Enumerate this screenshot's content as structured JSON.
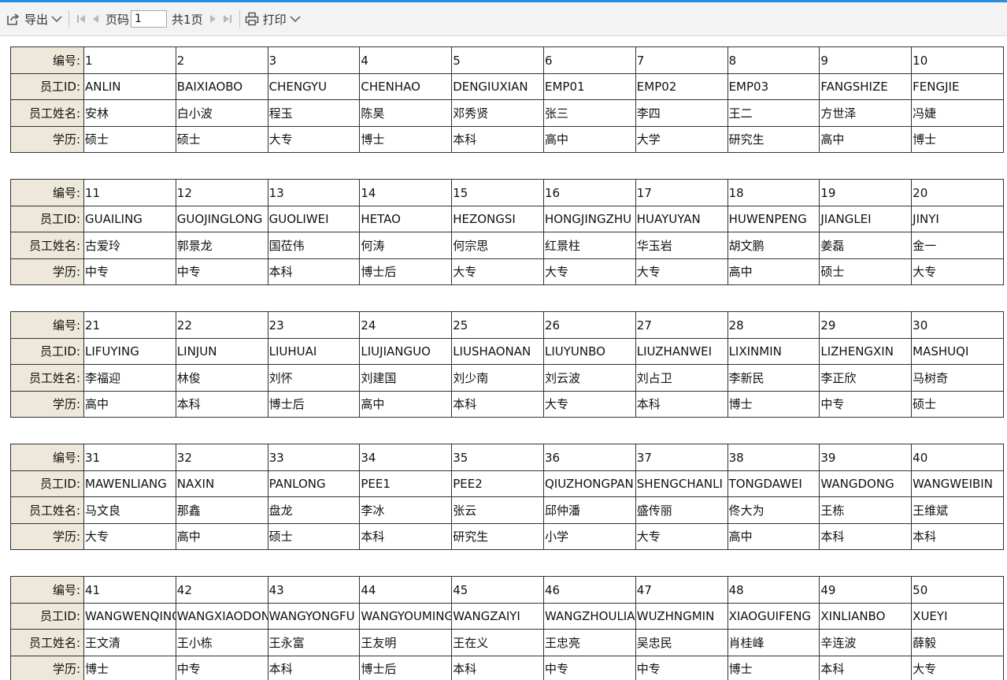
{
  "toolbar": {
    "export_label": "导出",
    "page_label": "页码",
    "page_value": "1",
    "total_label": "共1页",
    "print_label": "打印"
  },
  "row_labels": {
    "id": "编号:",
    "emp_id": "员工ID:",
    "name": "员工姓名:",
    "edu": "学历:"
  },
  "blocks": [
    {
      "ids": [
        "1",
        "2",
        "3",
        "4",
        "5",
        "6",
        "7",
        "8",
        "9",
        "10"
      ],
      "emp_ids": [
        "ANLIN",
        "BAIXIAOBO",
        "CHENGYU",
        "CHENHAO",
        "DENGIUXIAN",
        "EMP01",
        "EMP02",
        "EMP03",
        "FANGSHIZE",
        "FENGJIE"
      ],
      "names": [
        "安林",
        "白小波",
        "程玉",
        "陈昊",
        "邓秀贤",
        "张三",
        "李四",
        "王二",
        "方世泽",
        "冯婕"
      ],
      "edus": [
        "硕士",
        "硕士",
        "大专",
        "博士",
        "本科",
        "高中",
        "大学",
        "研究生",
        "高中",
        "博士"
      ]
    },
    {
      "ids": [
        "11",
        "12",
        "13",
        "14",
        "15",
        "16",
        "17",
        "18",
        "19",
        "20"
      ],
      "emp_ids": [
        "GUAILING",
        "GUOJINGLONG",
        "GUOLIWEI",
        "HETAO",
        "HEZONGSI",
        "HONGJINGZHU",
        "HUAYUYAN",
        "HUWENPENG",
        "JIANGLEI",
        "JINYI"
      ],
      "names": [
        "古爱玲",
        "郭景龙",
        "国莅伟",
        "何涛",
        "何宗思",
        "红景柱",
        "华玉岩",
        "胡文鹏",
        "姜磊",
        "金一"
      ],
      "edus": [
        "中专",
        "中专",
        "本科",
        "博士后",
        "大专",
        "大专",
        "大专",
        "高中",
        "硕士",
        "大专"
      ]
    },
    {
      "ids": [
        "21",
        "22",
        "23",
        "24",
        "25",
        "26",
        "27",
        "28",
        "29",
        "30"
      ],
      "emp_ids": [
        "LIFUYING",
        "LINJUN",
        "LIUHUAI",
        "LIUJIANGUO",
        "LIUSHAONAN",
        "LIUYUNBO",
        "LIUZHANWEI",
        "LIXINMIN",
        "LIZHENGXIN",
        "MASHUQI"
      ],
      "names": [
        "李福迎",
        "林俊",
        "刘怀",
        "刘建国",
        "刘少南",
        "刘云波",
        "刘占卫",
        "李新民",
        "李正欣",
        "马树奇"
      ],
      "edus": [
        "高中",
        "本科",
        "博士后",
        "高中",
        "本科",
        "大专",
        "本科",
        "博士",
        "中专",
        "硕士"
      ]
    },
    {
      "ids": [
        "31",
        "32",
        "33",
        "34",
        "35",
        "36",
        "37",
        "38",
        "39",
        "40"
      ],
      "emp_ids": [
        "MAWENLIANG",
        "NAXIN",
        "PANLONG",
        "PEE1",
        "PEE2",
        "QIUZHONGPAN",
        "SHENGCHANLI",
        "TONGDAWEI",
        "WANGDONG",
        "WANGWEIBIN"
      ],
      "names": [
        "马文良",
        "那鑫",
        "盘龙",
        "李冰",
        "张云",
        "邱仲潘",
        "盛传丽",
        "佟大为",
        "王栋",
        "王维斌"
      ],
      "edus": [
        "大专",
        "高中",
        "硕士",
        "本科",
        "研究生",
        "小学",
        "大专",
        "高中",
        "本科",
        "本科"
      ]
    },
    {
      "ids": [
        "41",
        "42",
        "43",
        "44",
        "45",
        "46",
        "47",
        "48",
        "49",
        "50"
      ],
      "emp_ids": [
        "WANGWENQING",
        "WANGXIAODONG",
        "WANGYONGFU",
        "WANGYOUMING",
        "WANGZAIYI",
        "WANGZHOULIANG",
        "WUZHNGMIN",
        "XIAOGUIFENG",
        "XINLIANBO",
        "XUEYI"
      ],
      "names": [
        "王文清",
        "王小栋",
        "王永富",
        "王友明",
        "王在义",
        "王忠亮",
        "吴忠民",
        "肖桂峰",
        "辛连波",
        "薛毅"
      ],
      "edus": [
        "博士",
        "中专",
        "本科",
        "博士后",
        "本科",
        "中专",
        "中专",
        "博士",
        "本科",
        "大专"
      ]
    }
  ]
}
